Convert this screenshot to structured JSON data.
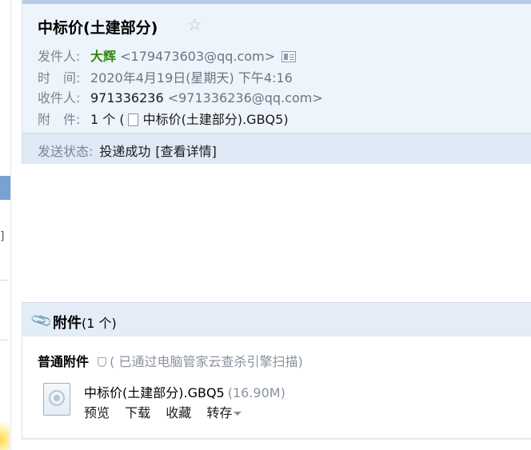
{
  "mail": {
    "subject": "中标价(土建部分)",
    "sender_label": "发件人:",
    "sender_name": "大辉",
    "sender_addr": "<179473603@qq.com>",
    "time_label": "时　间:",
    "time_value": "2020年4月19日(星期天) 下午4:16",
    "to_label": "收件人:",
    "to_name": "971336236",
    "to_addr": "<971336236@qq.com>",
    "attach_label": "附　件:",
    "attach_count": "1 个 (",
    "attach_name": "中标价(土建部分).GBQ5)",
    "status_label": "发送状态:",
    "status_value": "投递成功",
    "status_detail": "[查看详情]"
  },
  "attachments": {
    "title": "附件",
    "count": "(1 个)",
    "normal_label": "普通附件",
    "scan_text": "( 已通过电脑管家云查杀引擎扫描)",
    "file_name": "中标价(土建部分).GBQ5",
    "file_size": "(16.90M)",
    "actions": {
      "preview": "预览",
      "download": "下载",
      "favorite": "收藏",
      "save": "转存"
    }
  },
  "sidebar_fragment": {
    "bracket": "]"
  },
  "icons": {
    "star": "star-icon",
    "contact_card": "contact-card-icon",
    "paperclip": "paperclip-icon",
    "shield": "shield-icon",
    "file": "file-icon"
  },
  "colors": {
    "header_bg": "#eef4fb",
    "status_bg": "#dfe9f6",
    "sender_green": "#2e8a12",
    "muted_label": "#7b8490"
  }
}
